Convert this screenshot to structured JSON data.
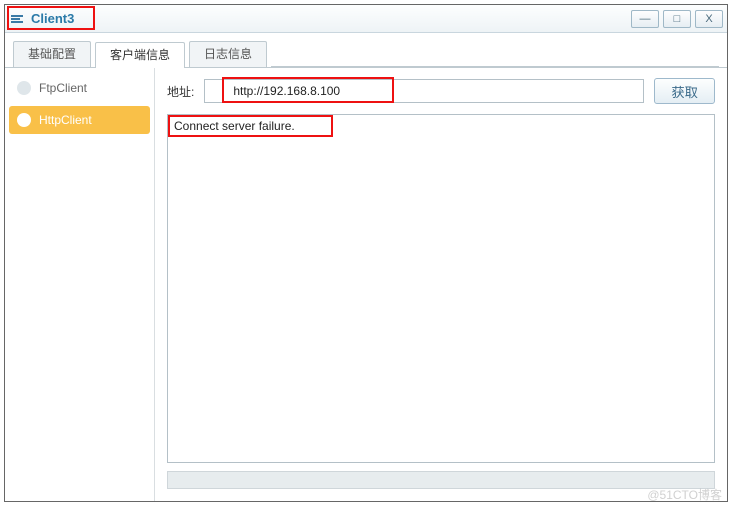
{
  "window": {
    "title": "Client3",
    "controls": {
      "min": "—",
      "max": "□",
      "close": "X"
    }
  },
  "tabs": [
    {
      "label": "基础配置",
      "active": false
    },
    {
      "label": "客户端信息",
      "active": true
    },
    {
      "label": "日志信息",
      "active": false
    }
  ],
  "sidebar": {
    "items": [
      {
        "label": "FtpClient",
        "selected": false
      },
      {
        "label": "HttpClient",
        "selected": true
      }
    ]
  },
  "main": {
    "url_label": "地址:",
    "url_value": "http://192.168.8.100",
    "fetch_label": "获取",
    "output_text": "Connect server failure."
  },
  "watermark": "@51CTO博客"
}
